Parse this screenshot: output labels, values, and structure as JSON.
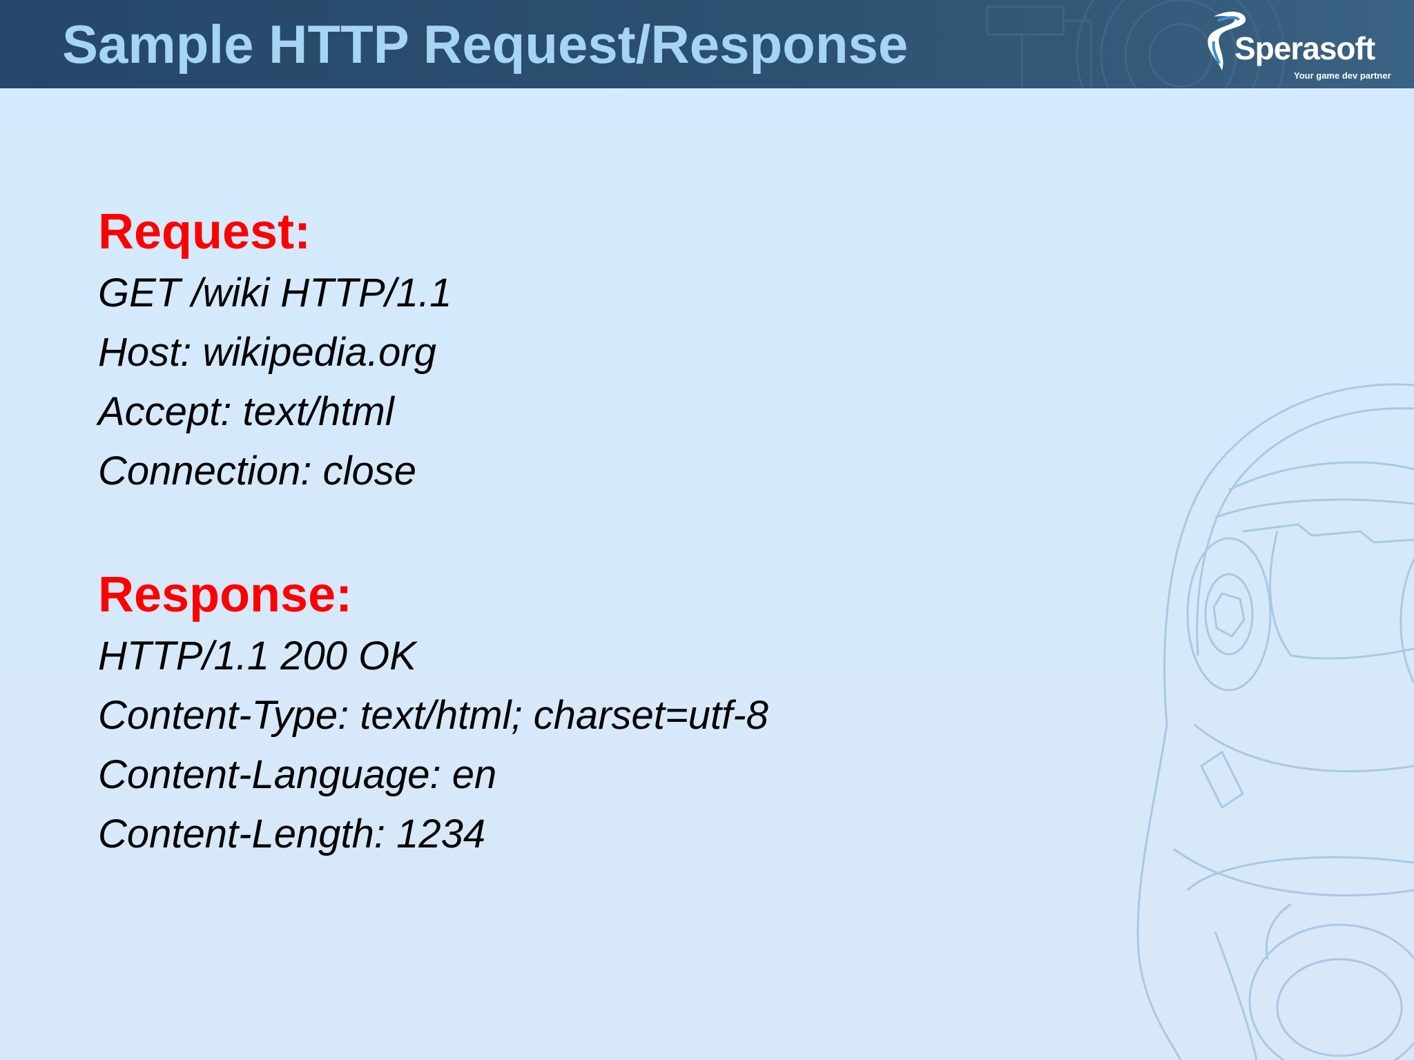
{
  "slide": {
    "title": "Sample HTTP Request/Response"
  },
  "logo": {
    "name": "Sperasoft",
    "tagline": "Your game dev partner"
  },
  "request": {
    "heading": "Request:",
    "lines": [
      "GET /wiki HTTP/1.1",
      "Host: wikipedia.org",
      "Accept: text/html",
      "Connection: close"
    ]
  },
  "response": {
    "heading": "Response:",
    "lines": [
      "HTTP/1.1 200 OK",
      "Content-Type: text/html; charset=utf-8",
      "Content-Language: en",
      "Content-Length: 1234"
    ]
  },
  "colors": {
    "header_background": "#2c5070",
    "title": "#a6d4f3",
    "section_heading": "#ff0000",
    "body_text": "#000000",
    "slide_background": "#d3eafe"
  }
}
